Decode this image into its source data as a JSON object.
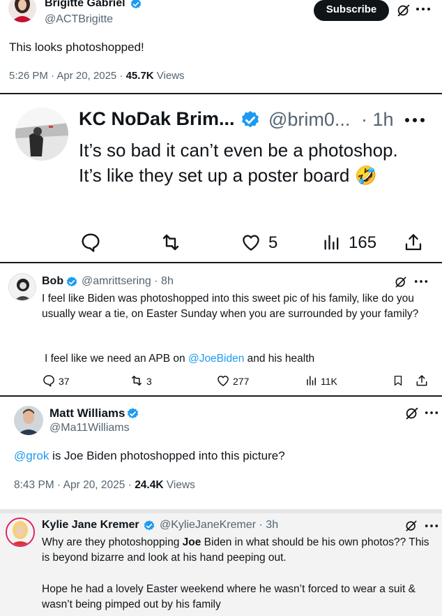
{
  "post1": {
    "name": "Brigitte Gabriel",
    "handle": "@ACTBrigitte",
    "subscribe_label": "Subscribe",
    "text": "This looks photoshopped!",
    "time": "5:26 PM · Apr 20, 2025 · ",
    "views_count": "45.7K",
    "views_label": " Views"
  },
  "post2": {
    "name": "KC NoDak Brim...",
    "handle": "@brim0...",
    "age": "· 1h",
    "text": "It’s so bad it can’t even be a photoshop. It’s like they set up a poster board 🤣",
    "likes": "5",
    "views": "165"
  },
  "post3": {
    "name": "Bob",
    "handle": "@amrittsering · 8h",
    "text_line1": "I feel like Biden was photoshopped into this sweet pic of his family, like do you usually wear a tie, on Easter Sunday when you are surrounded by your family?",
    "text_pre": "I feel like we need an APB on ",
    "mention": "@JoeBiden",
    "text_post": " and his health",
    "replies": "37",
    "reposts": "3",
    "likes": "277",
    "views": "11K"
  },
  "post4": {
    "name": "Matt Williams",
    "handle": "@Ma11Williams",
    "mention": "@grok",
    "text": " is Joe Biden photoshopped into this picture?",
    "time": "8:43 PM · Apr 20, 2025 · ",
    "views_count": "24.4K",
    "views_label": " Views"
  },
  "post5": {
    "name": "Kylie Jane Kremer",
    "handle": "@KylieJaneKremer · 3h",
    "text_pre": "Why are they photoshopping ",
    "text_bold": "Joe",
    "text_post": " Biden in what should be his own photos?? This is beyond bizarre and look at his hand peeping out.",
    "text_p2": "Hope he had a lovely Easter weekend where he wasn’t forced to wear a suit & wasn’t being pimped out by his family"
  },
  "colors": {
    "verified": "#1d9bf0",
    "link": "#1d9bf0",
    "text": "#0f1419",
    "muted": "#536471"
  }
}
